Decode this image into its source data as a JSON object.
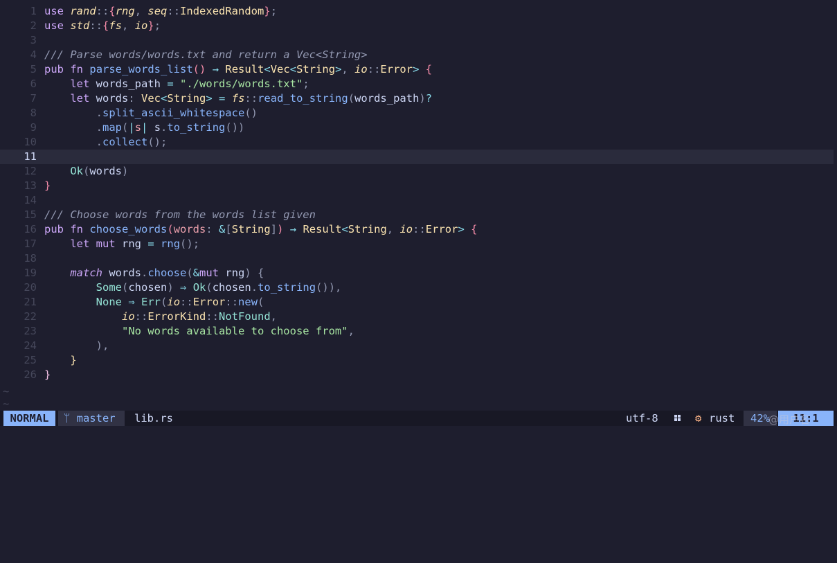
{
  "editor": {
    "current_line": 11,
    "lines": [
      {
        "n": "1",
        "tokens": [
          [
            "kw",
            "use"
          ],
          [
            "va",
            " "
          ],
          [
            "ns",
            "rand"
          ],
          [
            "pu",
            "::"
          ],
          [
            "br",
            "{"
          ],
          [
            "ns",
            "rng"
          ],
          [
            "pu",
            ", "
          ],
          [
            "ns",
            "seq"
          ],
          [
            "pu",
            "::"
          ],
          [
            "ty",
            "IndexedRandom"
          ],
          [
            "br",
            "}"
          ],
          [
            "pu",
            ";"
          ]
        ]
      },
      {
        "n": "2",
        "tokens": [
          [
            "kw",
            "use"
          ],
          [
            "va",
            " "
          ],
          [
            "ns",
            "std"
          ],
          [
            "pu",
            "::"
          ],
          [
            "br",
            "{"
          ],
          [
            "ns",
            "fs"
          ],
          [
            "pu",
            ", "
          ],
          [
            "ns",
            "io"
          ],
          [
            "br",
            "}"
          ],
          [
            "pu",
            ";"
          ]
        ]
      },
      {
        "n": "3",
        "tokens": []
      },
      {
        "n": "4",
        "tokens": [
          [
            "cm",
            "/// Parse words/words.txt and return a Vec<String>"
          ]
        ]
      },
      {
        "n": "5",
        "tokens": [
          [
            "kw",
            "pub"
          ],
          [
            "va",
            " "
          ],
          [
            "kw",
            "fn"
          ],
          [
            "va",
            " "
          ],
          [
            "fn",
            "parse_words_list"
          ],
          [
            "br",
            "()"
          ],
          [
            "va",
            " "
          ],
          [
            "op",
            "→"
          ],
          [
            "va",
            " "
          ],
          [
            "ty",
            "Result"
          ],
          [
            "op",
            "<"
          ],
          [
            "ty",
            "Vec"
          ],
          [
            "op",
            "<"
          ],
          [
            "ty",
            "String"
          ],
          [
            "op",
            ">"
          ],
          [
            "pu",
            ", "
          ],
          [
            "ns",
            "io"
          ],
          [
            "pu",
            "::"
          ],
          [
            "ty",
            "Error"
          ],
          [
            "op",
            ">"
          ],
          [
            "va",
            " "
          ],
          [
            "br",
            "{"
          ]
        ]
      },
      {
        "n": "6",
        "tokens": [
          [
            "va",
            "    "
          ],
          [
            "kw",
            "let"
          ],
          [
            "va",
            " words_path "
          ],
          [
            "op",
            "="
          ],
          [
            "va",
            " "
          ],
          [
            "st",
            "\"./words/words.txt\""
          ],
          [
            "pu",
            ";"
          ]
        ]
      },
      {
        "n": "7",
        "tokens": [
          [
            "va",
            "    "
          ],
          [
            "kw",
            "let"
          ],
          [
            "va",
            " words"
          ],
          [
            "pu",
            ":"
          ],
          [
            "va",
            " "
          ],
          [
            "ty",
            "Vec"
          ],
          [
            "op",
            "<"
          ],
          [
            "ty",
            "String"
          ],
          [
            "op",
            ">"
          ],
          [
            "va",
            " "
          ],
          [
            "op",
            "="
          ],
          [
            "va",
            " "
          ],
          [
            "ns",
            "fs"
          ],
          [
            "pu",
            "::"
          ],
          [
            "fn",
            "read_to_string"
          ],
          [
            "pu",
            "("
          ],
          [
            "va",
            "words_path"
          ],
          [
            "pu",
            ")"
          ],
          [
            "op",
            "?"
          ]
        ]
      },
      {
        "n": "8",
        "tokens": [
          [
            "va",
            "        "
          ],
          [
            "pu",
            "."
          ],
          [
            "fn",
            "split_ascii_whitespace"
          ],
          [
            "pu",
            "()"
          ]
        ]
      },
      {
        "n": "9",
        "tokens": [
          [
            "va",
            "        "
          ],
          [
            "pu",
            "."
          ],
          [
            "fn",
            "map"
          ],
          [
            "pu",
            "("
          ],
          [
            "op",
            "|"
          ],
          [
            "pa",
            "s"
          ],
          [
            "op",
            "|"
          ],
          [
            "va",
            " s"
          ],
          [
            "pu",
            "."
          ],
          [
            "fn",
            "to_string"
          ],
          [
            "pu",
            "())"
          ]
        ]
      },
      {
        "n": "10",
        "tokens": [
          [
            "va",
            "        "
          ],
          [
            "pu",
            "."
          ],
          [
            "fn",
            "collect"
          ],
          [
            "pu",
            "();"
          ]
        ]
      },
      {
        "n": "11",
        "tokens": []
      },
      {
        "n": "12",
        "tokens": [
          [
            "va",
            "    "
          ],
          [
            "en",
            "Ok"
          ],
          [
            "pu",
            "("
          ],
          [
            "va",
            "words"
          ],
          [
            "pu",
            ")"
          ]
        ]
      },
      {
        "n": "13",
        "tokens": [
          [
            "br",
            "}"
          ]
        ]
      },
      {
        "n": "14",
        "tokens": []
      },
      {
        "n": "15",
        "tokens": [
          [
            "cm",
            "/// Choose words from the words list given"
          ]
        ]
      },
      {
        "n": "16",
        "tokens": [
          [
            "kw",
            "pub"
          ],
          [
            "va",
            " "
          ],
          [
            "kw",
            "fn"
          ],
          [
            "va",
            " "
          ],
          [
            "fn",
            "choose_words"
          ],
          [
            "br",
            "("
          ],
          [
            "pa",
            "words"
          ],
          [
            "pu",
            ": "
          ],
          [
            "op",
            "&"
          ],
          [
            "pu",
            "["
          ],
          [
            "ty",
            "String"
          ],
          [
            "pu",
            "]"
          ],
          [
            "br",
            ")"
          ],
          [
            "va",
            " "
          ],
          [
            "op",
            "→"
          ],
          [
            "va",
            " "
          ],
          [
            "ty",
            "Result"
          ],
          [
            "op",
            "<"
          ],
          [
            "ty",
            "String"
          ],
          [
            "pu",
            ", "
          ],
          [
            "ns",
            "io"
          ],
          [
            "pu",
            "::"
          ],
          [
            "ty",
            "Error"
          ],
          [
            "op",
            ">"
          ],
          [
            "va",
            " "
          ],
          [
            "br",
            "{"
          ]
        ]
      },
      {
        "n": "17",
        "tokens": [
          [
            "va",
            "    "
          ],
          [
            "kw",
            "let"
          ],
          [
            "va",
            " "
          ],
          [
            "kw",
            "mut"
          ],
          [
            "va",
            " rng "
          ],
          [
            "op",
            "="
          ],
          [
            "va",
            " "
          ],
          [
            "fn",
            "rng"
          ],
          [
            "pu",
            "();"
          ]
        ]
      },
      {
        "n": "18",
        "tokens": []
      },
      {
        "n": "19",
        "tokens": [
          [
            "va",
            "    "
          ],
          [
            "kwi",
            "match"
          ],
          [
            "va",
            " words"
          ],
          [
            "pu",
            "."
          ],
          [
            "fn",
            "choose"
          ],
          [
            "pu",
            "("
          ],
          [
            "op",
            "&"
          ],
          [
            "kw",
            "mut"
          ],
          [
            "va",
            " rng"
          ],
          [
            "pu",
            ")"
          ],
          [
            "va",
            " "
          ],
          [
            "pu",
            "{"
          ]
        ]
      },
      {
        "n": "20",
        "tokens": [
          [
            "va",
            "        "
          ],
          [
            "en",
            "Some"
          ],
          [
            "pu",
            "("
          ],
          [
            "va",
            "chosen"
          ],
          [
            "pu",
            ")"
          ],
          [
            "va",
            " "
          ],
          [
            "op",
            "⇒"
          ],
          [
            "va",
            " "
          ],
          [
            "en",
            "Ok"
          ],
          [
            "pu",
            "("
          ],
          [
            "va",
            "chosen"
          ],
          [
            "pu",
            "."
          ],
          [
            "fn",
            "to_string"
          ],
          [
            "pu",
            "()),"
          ]
        ]
      },
      {
        "n": "21",
        "tokens": [
          [
            "va",
            "        "
          ],
          [
            "en",
            "None"
          ],
          [
            "va",
            " "
          ],
          [
            "op",
            "⇒"
          ],
          [
            "va",
            " "
          ],
          [
            "en",
            "Err"
          ],
          [
            "pu",
            "("
          ],
          [
            "ns",
            "io"
          ],
          [
            "pu",
            "::"
          ],
          [
            "ty",
            "Error"
          ],
          [
            "pu",
            "::"
          ],
          [
            "fn",
            "new"
          ],
          [
            "pu",
            "("
          ]
        ]
      },
      {
        "n": "22",
        "tokens": [
          [
            "va",
            "            "
          ],
          [
            "ns",
            "io"
          ],
          [
            "pu",
            "::"
          ],
          [
            "ty",
            "ErrorKind"
          ],
          [
            "pu",
            "::"
          ],
          [
            "en",
            "NotFound"
          ],
          [
            "pu",
            ","
          ]
        ]
      },
      {
        "n": "23",
        "tokens": [
          [
            "va",
            "            "
          ],
          [
            "st",
            "\"No words available to choose from\""
          ],
          [
            "pu",
            ","
          ]
        ]
      },
      {
        "n": "24",
        "tokens": [
          [
            "va",
            "        "
          ],
          [
            "pu",
            "),"
          ]
        ]
      },
      {
        "n": "25",
        "tokens": [
          [
            "va",
            "    "
          ],
          [
            "ty",
            "}"
          ]
        ]
      },
      {
        "n": "26",
        "tokens": [
          [
            "mu",
            "}"
          ]
        ]
      }
    ],
    "tilde": "~"
  },
  "statusline": {
    "mode": "NORMAL",
    "branch_icon": "git-branch-icon",
    "branch": "master",
    "filename": "lib.rs",
    "encoding": "utf-8",
    "os_icon": "windows-icon",
    "filetype_icon": "rust-icon",
    "filetype": "rust",
    "percent": "42%",
    "position": "11:1"
  },
  "watermark": "@用户名"
}
